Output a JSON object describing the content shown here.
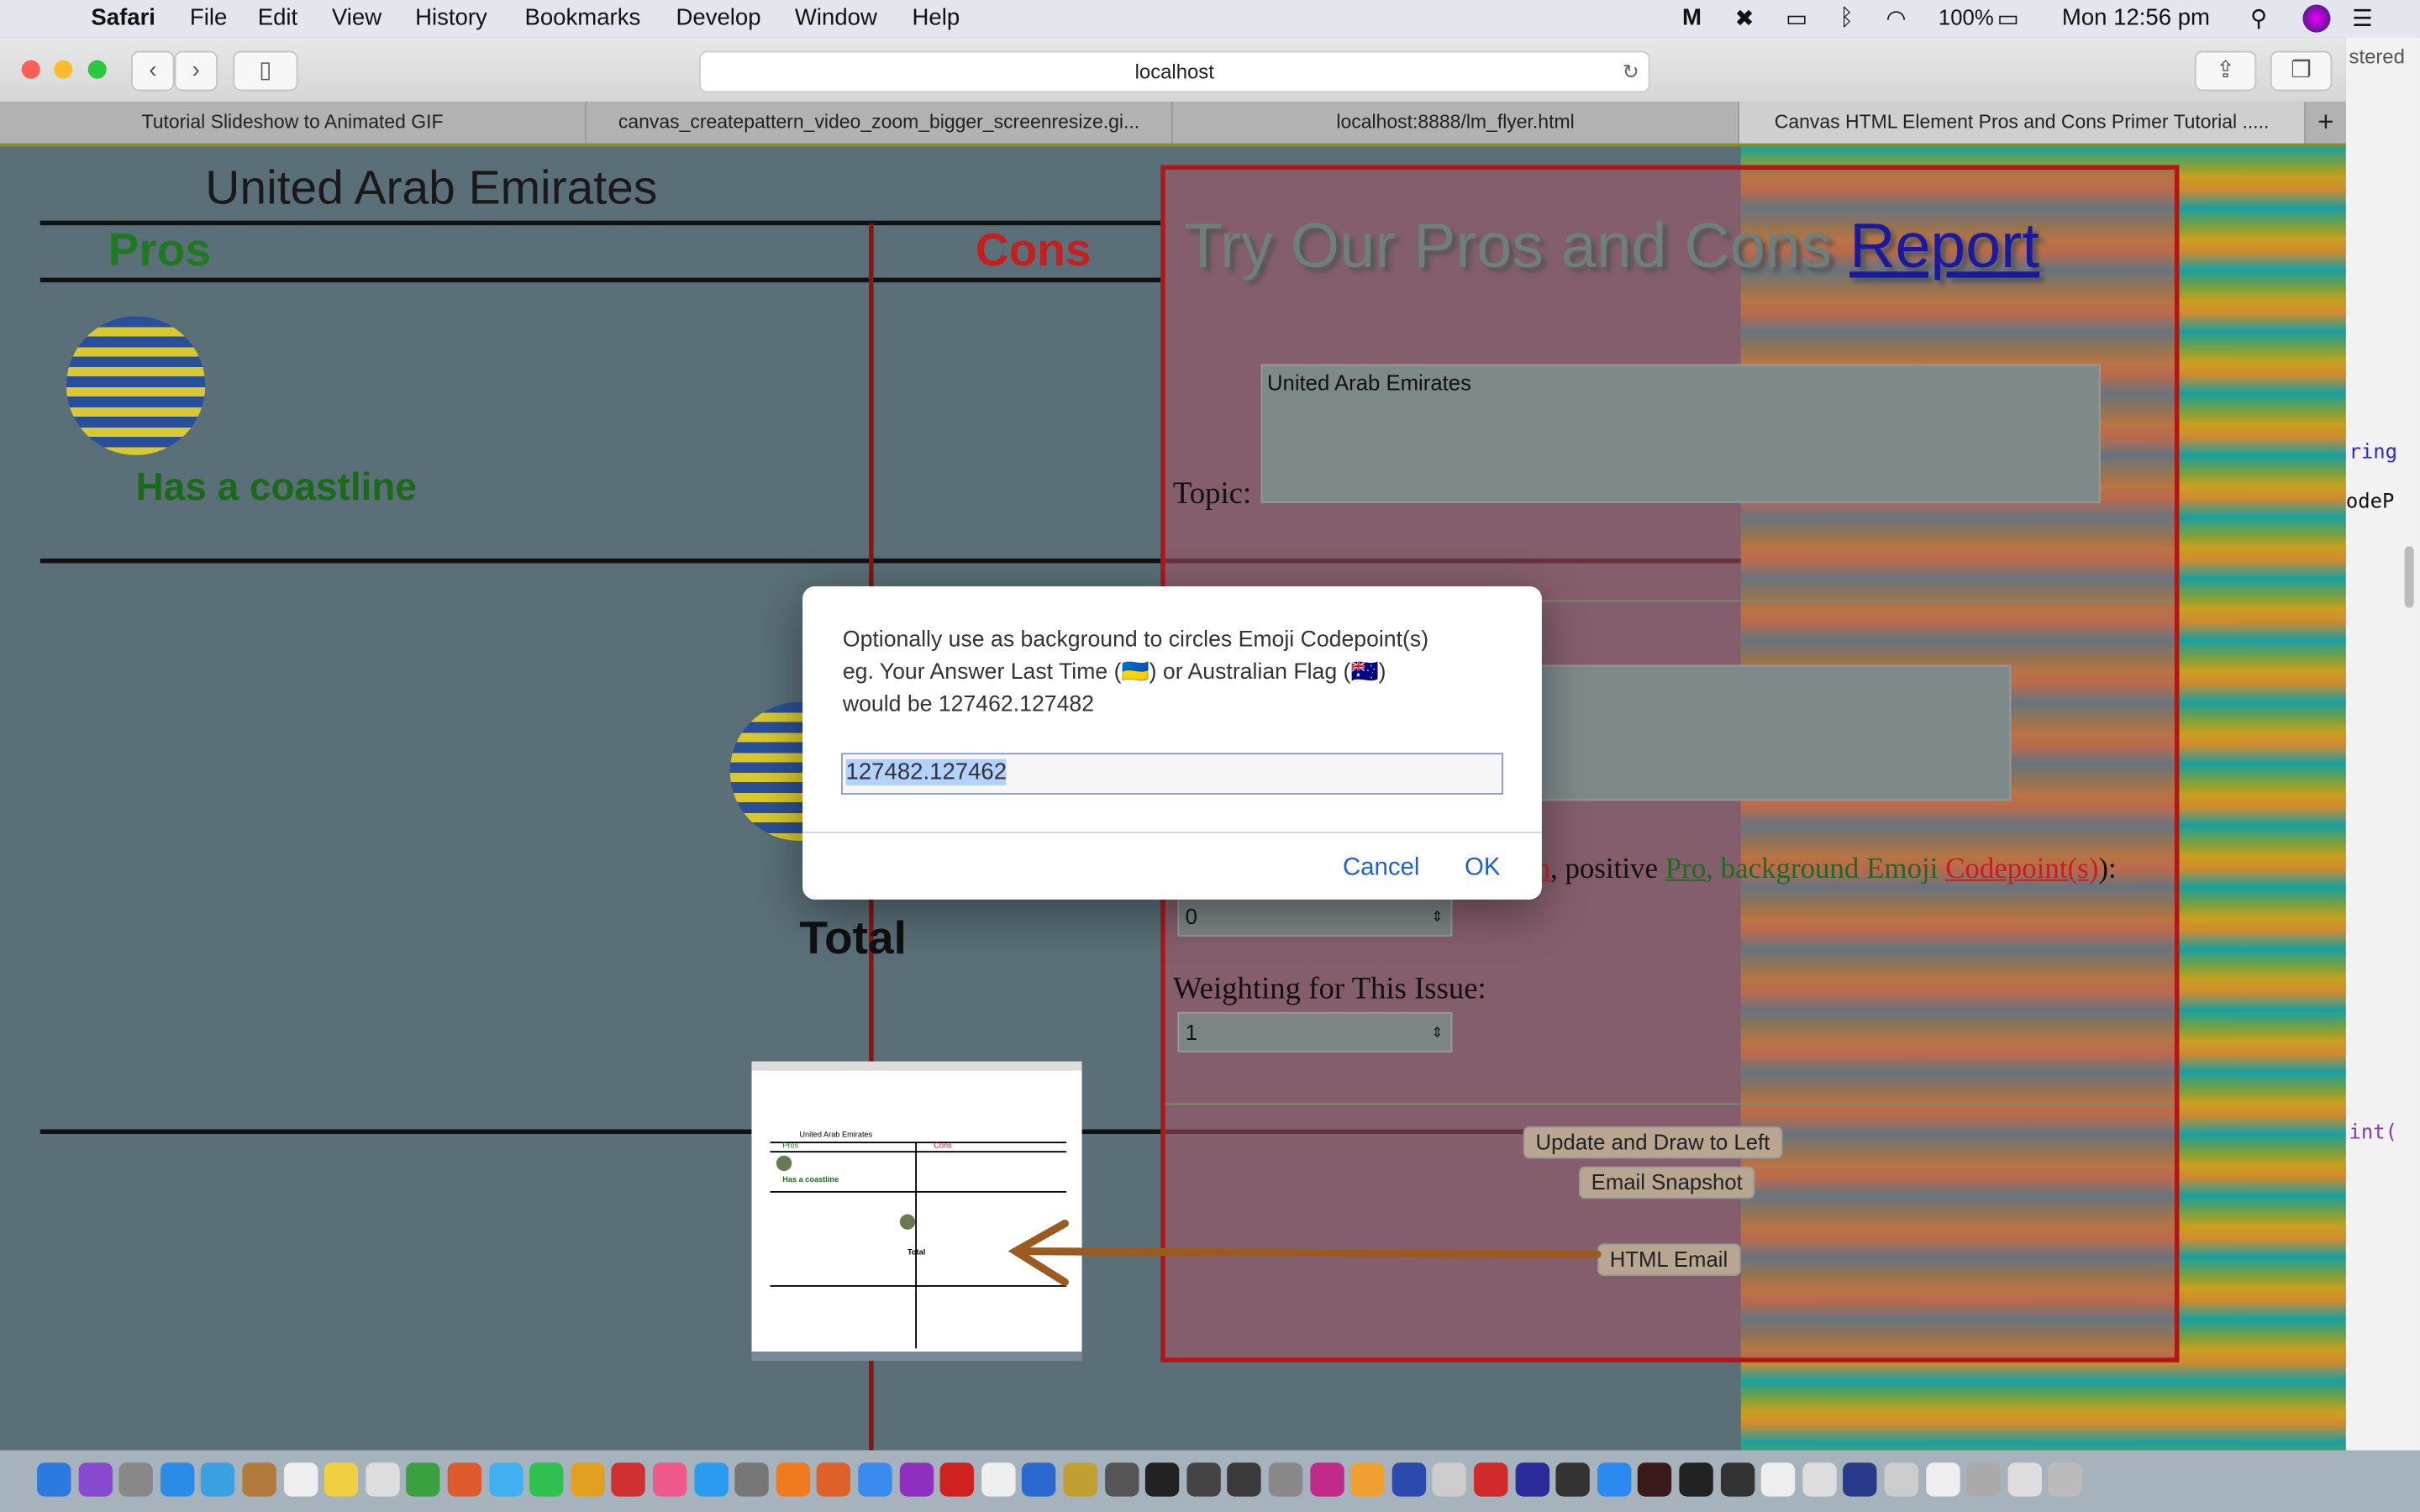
{
  "menubar": {
    "app": "Safari",
    "items": [
      "File",
      "Edit",
      "View",
      "History",
      "Bookmarks",
      "Develop",
      "Window",
      "Help"
    ],
    "battery": "100%",
    "clock": "Mon 12:56 pm"
  },
  "toolbar": {
    "url": "localhost"
  },
  "tabs": [
    {
      "label": "Tutorial Slideshow to Animated GIF"
    },
    {
      "label": "canvas_createpattern_video_zoom_bigger_screenresize.gi..."
    },
    {
      "label": "localhost:8888/lm_flyer.html"
    },
    {
      "label": "Canvas HTML Element Pros and Cons Primer Tutorial .....",
      "active": true
    }
  ],
  "canvas": {
    "title": "United Arab Emirates",
    "pros": "Pros",
    "cons": "Cons",
    "pro_item": "Has a coastline",
    "total": "Total"
  },
  "form": {
    "heading": "Try Our Pros and Cons ",
    "heading_link": "Report",
    "topic_label": "Topic:",
    "topic_value": "United Arab Emirates",
    "issue_label_visible": "n",
    "issue_label_mid": ", positive ",
    "issue_pro": "Pro",
    "issue_label_tail": ", background Emoji ",
    "issue_codepoint": "Codepoint(s)",
    "issue_end": "):",
    "issue_value": "0",
    "weight_label": "Weighting for This Issue:",
    "weight_value": "1",
    "update_button": "Update and Draw to Left",
    "email_button": "Email Snapshot",
    "html_email_button": "HTML Email"
  },
  "thumbnail": {
    "title": "United Arab Emirates",
    "pros": "Pros",
    "cons": "Cons",
    "pro_item": "Has a coastline",
    "total": "Total"
  },
  "sidebar_right": {
    "text1": "stered",
    "text2": "ring",
    "text3": "odeP",
    "text4": "int("
  },
  "dialog": {
    "message_line1": "Optionally use as background to circles Emoji Codepoint(s)",
    "message_line2a": "eg. Your Answer Last Time (",
    "flag1": "🇺🇦",
    "message_line2b": ") or Australian Flag (",
    "flag2": "🇦🇺",
    "message_line2c": ")",
    "message_line3": "would be 127462.127482",
    "input_value": "127482.127462",
    "cancel": "Cancel",
    "ok": "OK"
  },
  "colors": {
    "accent": "#1a62d6",
    "pros": "#1f7a1f",
    "cons": "#c81e1e",
    "form_border": "#b01818"
  }
}
